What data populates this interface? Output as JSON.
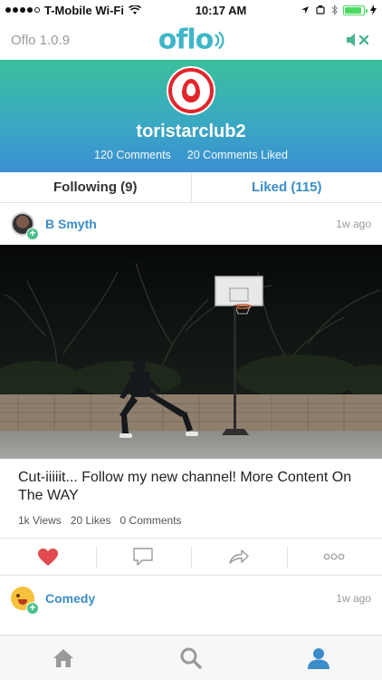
{
  "status_bar": {
    "carrier": "T-Mobile Wi-Fi",
    "time": "10:17 AM",
    "battery_level": 0.9,
    "signal_bars": 4
  },
  "nav": {
    "app_version": "Oflo 1.0.9",
    "logo_text": "oflo",
    "mute_icon": "speaker-mute-icon"
  },
  "profile": {
    "username": "toristarclub2",
    "comments_count": "120 Comments",
    "liked_count": "20 Comments Liked"
  },
  "tabs": {
    "following": "Following (9)",
    "liked": "Liked (115)"
  },
  "post": {
    "author": "B Smyth",
    "time": "1w ago",
    "caption": "Cut-iiiiit... Follow my new channel! More Content On The WAY",
    "views": "1k Views",
    "likes": "20 Likes",
    "comments": "0 Comments"
  },
  "post2": {
    "author": "Comedy",
    "time": "1w ago"
  },
  "colors": {
    "accent_blue": "#3b8dc9",
    "accent_green": "#4cbf8c",
    "heart_red": "#e24a4f"
  }
}
